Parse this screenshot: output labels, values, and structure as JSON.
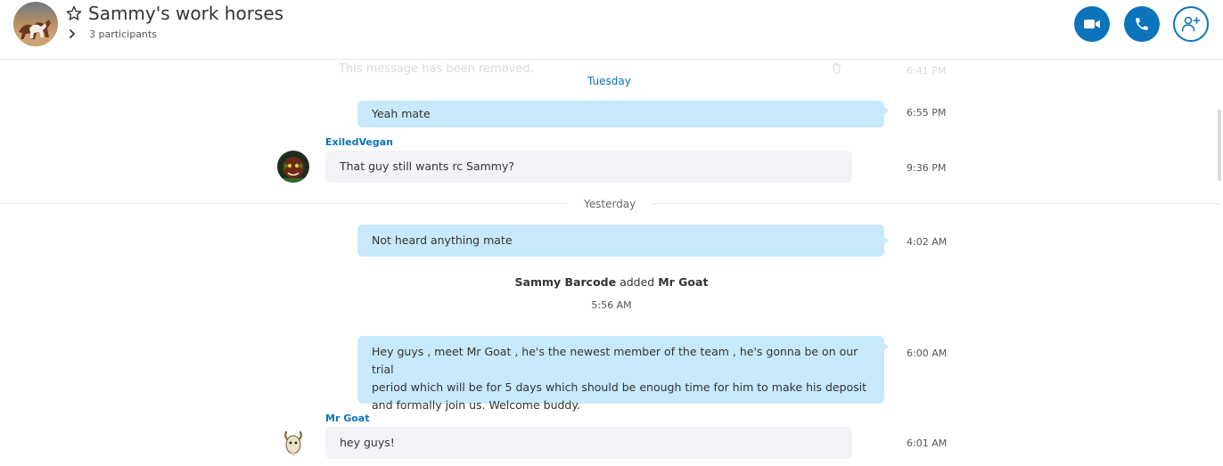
{
  "header": {
    "title": "Sammy's work horses",
    "participants": "3 participants",
    "accent": "#0b74ba"
  },
  "icons": {
    "favorite": "star-outline-icon",
    "expand": "chevron-right-icon",
    "video": "video-camera-icon",
    "call": "phone-icon",
    "add_people": "add-person-icon",
    "delete": "trash-icon"
  },
  "messages": {
    "removed": {
      "text": "This message has been removed.",
      "time": "6:41 PM"
    },
    "day1": "Tuesday",
    "m1": {
      "text": "Yeah mate",
      "time": "6:55 PM"
    },
    "m2": {
      "sender": "ExiledVegan",
      "text": "That guy still wants rc Sammy?",
      "time": "9:36 PM"
    },
    "day2": "Yesterday",
    "m3": {
      "text": "Not heard anything mate",
      "time": "4:02 AM"
    },
    "system": {
      "actor": "Sammy Barcode",
      "verb": "added",
      "target": "Mr Goat",
      "time": "5:56 AM"
    },
    "m4": {
      "lines": [
        "Hey guys , meet Mr Goat  , he's the newest member of the team , he's gonna be on our trial",
        "period which will be for 5 days which should be enough time for him to make his deposit",
        "and formally join us. Welcome buddy."
      ],
      "time": "6:00 AM"
    },
    "m5": {
      "sender": "Mr Goat",
      "text": "hey guys!",
      "time": "6:01 AM"
    }
  },
  "colors": {
    "outgoing_bubble": "#c7e9fb",
    "incoming_bubble": "#f1f3f6",
    "day_tuesday": "#0b74ba",
    "day_yesterday": "#666666"
  }
}
